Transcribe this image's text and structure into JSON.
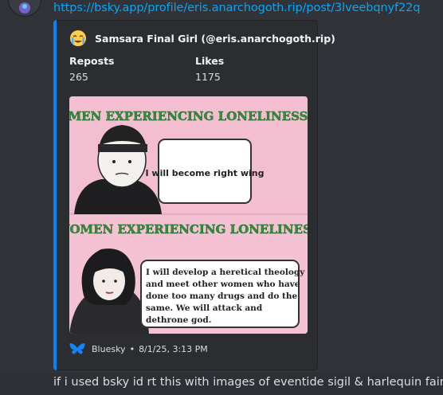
{
  "message": {
    "link_text": "https://bsky.app/profile/eris.anarchogoth.rip/post/3lveebqnyf22q",
    "text": "if i used bsky id rt this with images of eventide sigil & harlequin fair"
  },
  "embed": {
    "accent_color": "#0085ff",
    "author_emoji": "face-with-tears-emoji",
    "author": "Samsara Final Girl (@eris.anarchogoth.rip)",
    "fields": [
      {
        "label": "Reposts",
        "value": "265"
      },
      {
        "label": "Likes",
        "value": "1175"
      }
    ],
    "image": {
      "top_heading": "MEN EXPERIENCING LONELINESS",
      "top_bubble": "I will become right wing",
      "bottom_heading": "WOMEN EXPERIENCING LONELINESS",
      "bottom_bubble_lines": [
        "I will develop a heretical theology",
        "and meet other women who have",
        "done too many drugs and do the",
        "same. We will attack and",
        "dethrone god."
      ]
    },
    "footer": {
      "provider_icon": "bluesky-butterfly-icon",
      "provider": "Bluesky",
      "separator": "•",
      "timestamp": "8/1/25, 3:13 PM"
    }
  }
}
